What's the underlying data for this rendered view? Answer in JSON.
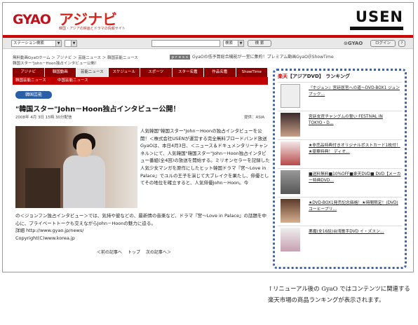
{
  "header": {
    "logo_gyao": "GYAO",
    "logo_asia": "アジナビ",
    "logo_sub": "韓国・アジアの映画とドラマの情報サイト",
    "usen": "USEN"
  },
  "searchbar": {
    "scope_select": "ステーション検索",
    "station_select": "",
    "search_input": "",
    "kind_select": "検索",
    "search_button": "検 索",
    "gyao_search": "GYAO",
    "login_button": "ログイン"
  },
  "breadcrumb": {
    "path": "無料動画GyaOホーム ＞ アジナビ ＞ 芸能ニュース ＞ 韓国芸能ニュース",
    "current": "韓国スター\"John－Hoon独占インタビュー公開！",
    "promo_tag": "ｐｒｅｓｓ",
    "promo_text": "GyaOの低予算総合機能が一堂に集約！プレミアム動画GyaO＠ShowTime"
  },
  "nav": {
    "tabs": [
      "アジナビ",
      "韓国動画",
      "芸能ニュース",
      "スケジュール",
      "スポーツ",
      "スター名鑑",
      "作品名鑑",
      "ShowTime"
    ],
    "active_index": 2,
    "subtabs": [
      "韓国芸能ニュース",
      "中国芸能ニュース"
    ]
  },
  "article": {
    "category": "韓国芸能",
    "title": "\"韓国スター\"John－Hoon独占インタビュー公開！",
    "date": "2008年 4月 3日 15時 30分配信",
    "author": "提供：ASIA",
    "body": "人気韓国\"韓国スター\"John－Hoonの独占インタビューを公開！＜株式会社USENが運営する完全無料ブロードバンド放送GyaOは、本日4月3日、＜ニュース＆ドキュメンタリーチャンネル＞にて、人気韓国\"韓国スター\"John－Hoon独占インタビュー番組(全4回)の放送を開始する。ミリオンセラーを記録した人気少女マンガを原作にしたヒット韓国ドラマ『宮～Love in Palace』でユルの王子を演じて大ブレイクを果たし、俳優としてその地位を確立すると、人気俳優John－Hoon。今",
    "tail": "の＜ジョンフン独占インタビュー＞では、気持や彼などの、最新情の音楽など、ドラマ『宮～Love in Palace』の話題を中心に、プライベートトークも交えながらJohn－Hoonの魅力に迫る。",
    "link_label": "詳細 http://www.gyao.jp/news/",
    "copyright": "Copyright(C)www.korea.jp",
    "pager": [
      "＜前の記事へ",
      "トップ",
      "次の記事へ＞"
    ]
  },
  "ranking": {
    "rakuten": "楽天",
    "header": "【アジアDVD】 ランキング",
    "items": [
      "『ホジュン』宮廷医官への道～DVD-BOX1 ジュンブック…",
      "宮廷女官チャングムの誓い FESTIVAL IN TOKYO・D…",
      "★非売品特典付きオリジナルポストカード1枚付！★豪華特典！ ディオ…",
      "■送料無料■10%OFF■楽天DVD■ DVD【メーカー特典DVD…",
      "★DVD-BOX1発売記念価格！★時間限定！(DVD)コーヒープリ…",
      "悪魔(全16話)台湾歌手DVD イ・ズスン…"
    ]
  },
  "caption": "↑リニューアル後の GyaO ではコンテンツに関連する楽天市場の商品ランキングが表示されます。"
}
